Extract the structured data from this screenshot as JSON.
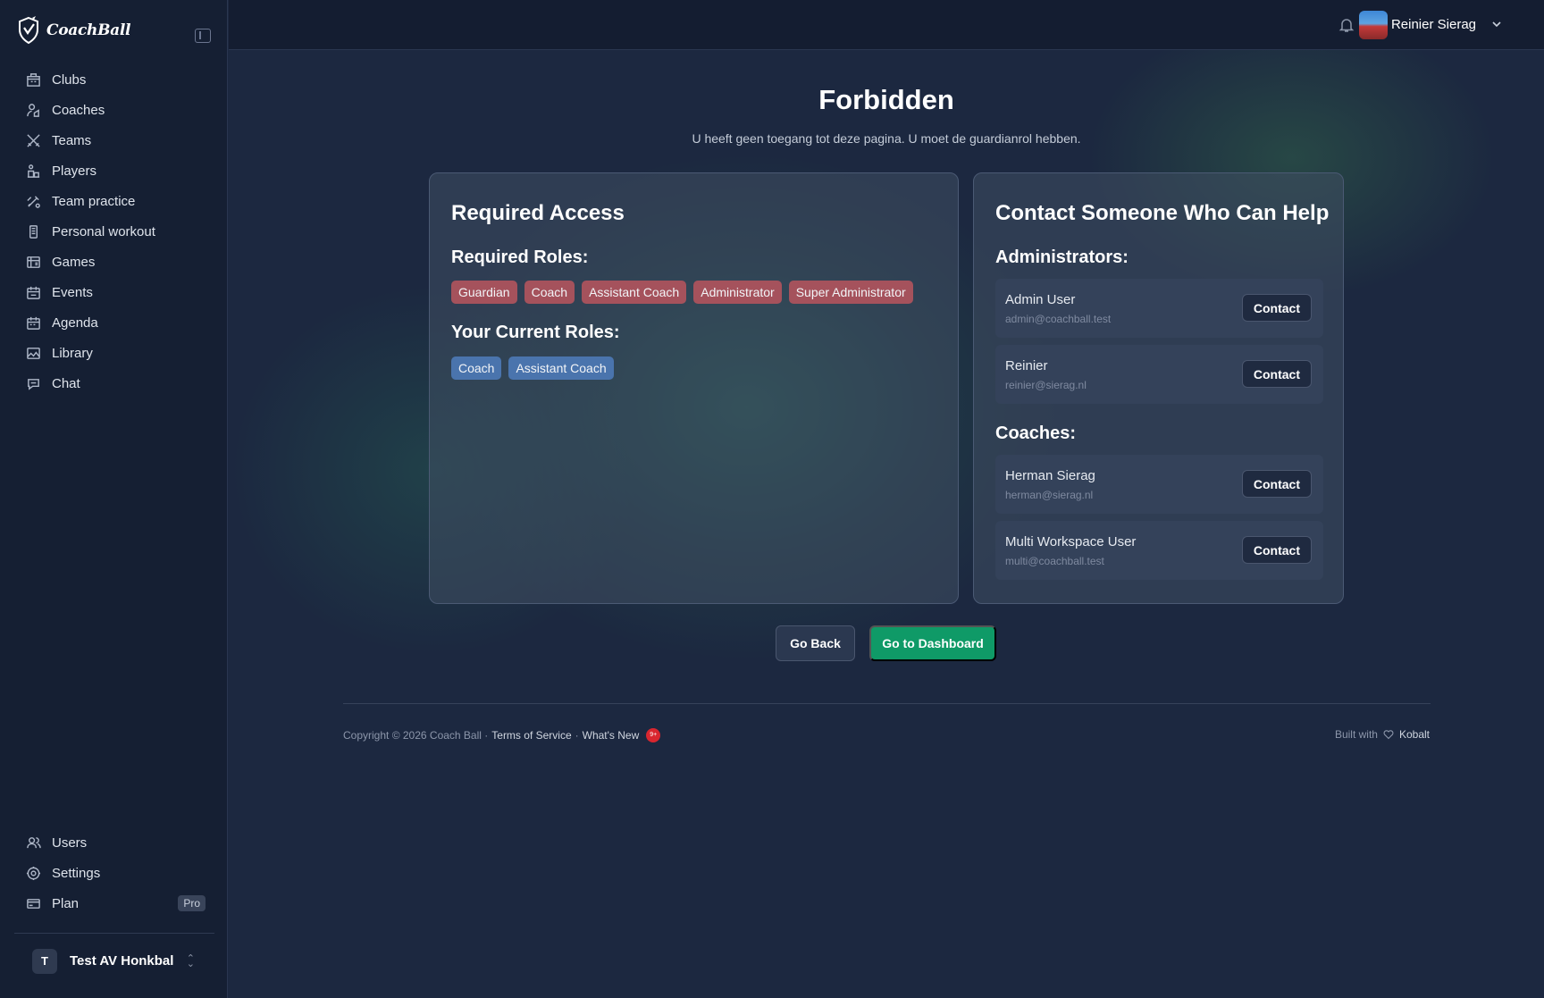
{
  "brand": {
    "name": "CoachBall"
  },
  "sidebar": {
    "items": [
      {
        "label": "Clubs",
        "icon": "building-icon"
      },
      {
        "label": "Coaches",
        "icon": "coaches-icon"
      },
      {
        "label": "Teams",
        "icon": "swords-icon"
      },
      {
        "label": "Players",
        "icon": "players-icon"
      },
      {
        "label": "Team practice",
        "icon": "practice-icon"
      },
      {
        "label": "Personal workout",
        "icon": "workout-icon"
      },
      {
        "label": "Games",
        "icon": "games-icon"
      },
      {
        "label": "Events",
        "icon": "events-icon"
      },
      {
        "label": "Agenda",
        "icon": "agenda-icon"
      },
      {
        "label": "Library",
        "icon": "library-icon"
      },
      {
        "label": "Chat",
        "icon": "chat-icon"
      }
    ],
    "bottom_items": [
      {
        "label": "Users",
        "icon": "users-icon"
      },
      {
        "label": "Settings",
        "icon": "gear-icon"
      },
      {
        "label": "Plan",
        "icon": "card-icon",
        "badge": "Pro"
      }
    ],
    "workspace": {
      "initial": "T",
      "name": "Test AV Honkbal"
    }
  },
  "topbar": {
    "user_name": "Reinier Sierag"
  },
  "page": {
    "title": "Forbidden",
    "subtitle": "U heeft geen toegang tot deze pagina. U moet de guardianrol hebben."
  },
  "required_access": {
    "title": "Required Access",
    "required_roles_label": "Required Roles:",
    "required_roles": [
      "Guardian",
      "Coach",
      "Assistant Coach",
      "Administrator",
      "Super Administrator"
    ],
    "current_roles_label": "Your Current Roles:",
    "current_roles": [
      "Coach",
      "Assistant Coach"
    ]
  },
  "contact": {
    "title": "Contact Someone Who Can Help",
    "administrators_label": "Administrators:",
    "administrators": [
      {
        "name": "Admin User",
        "email": "admin@coachball.test",
        "button": "Contact"
      },
      {
        "name": "Reinier",
        "email": "reinier@sierag.nl",
        "button": "Contact"
      }
    ],
    "coaches_label": "Coaches:",
    "coaches": [
      {
        "name": "Herman Sierag",
        "email": "herman@sierag.nl",
        "button": "Contact"
      },
      {
        "name": "Multi Workspace User",
        "email": "multi@coachball.test",
        "button": "Contact"
      }
    ]
  },
  "actions": {
    "back": "Go Back",
    "dashboard": "Go to Dashboard"
  },
  "footer": {
    "copyright": "Copyright © 2026 Coach Ball ·",
    "terms": "Terms of Service",
    "sep": "·",
    "whats_new": "What's New",
    "new_badge": "9+",
    "built_with": "Built with",
    "kobalt": "Kobalt"
  },
  "colors": {
    "sidebar_bg": "#151f33",
    "main_bg": "#1c2840",
    "required_badge": "#a5525c",
    "current_badge": "#4a74ad",
    "dashboard_button": "#0f9a67"
  }
}
